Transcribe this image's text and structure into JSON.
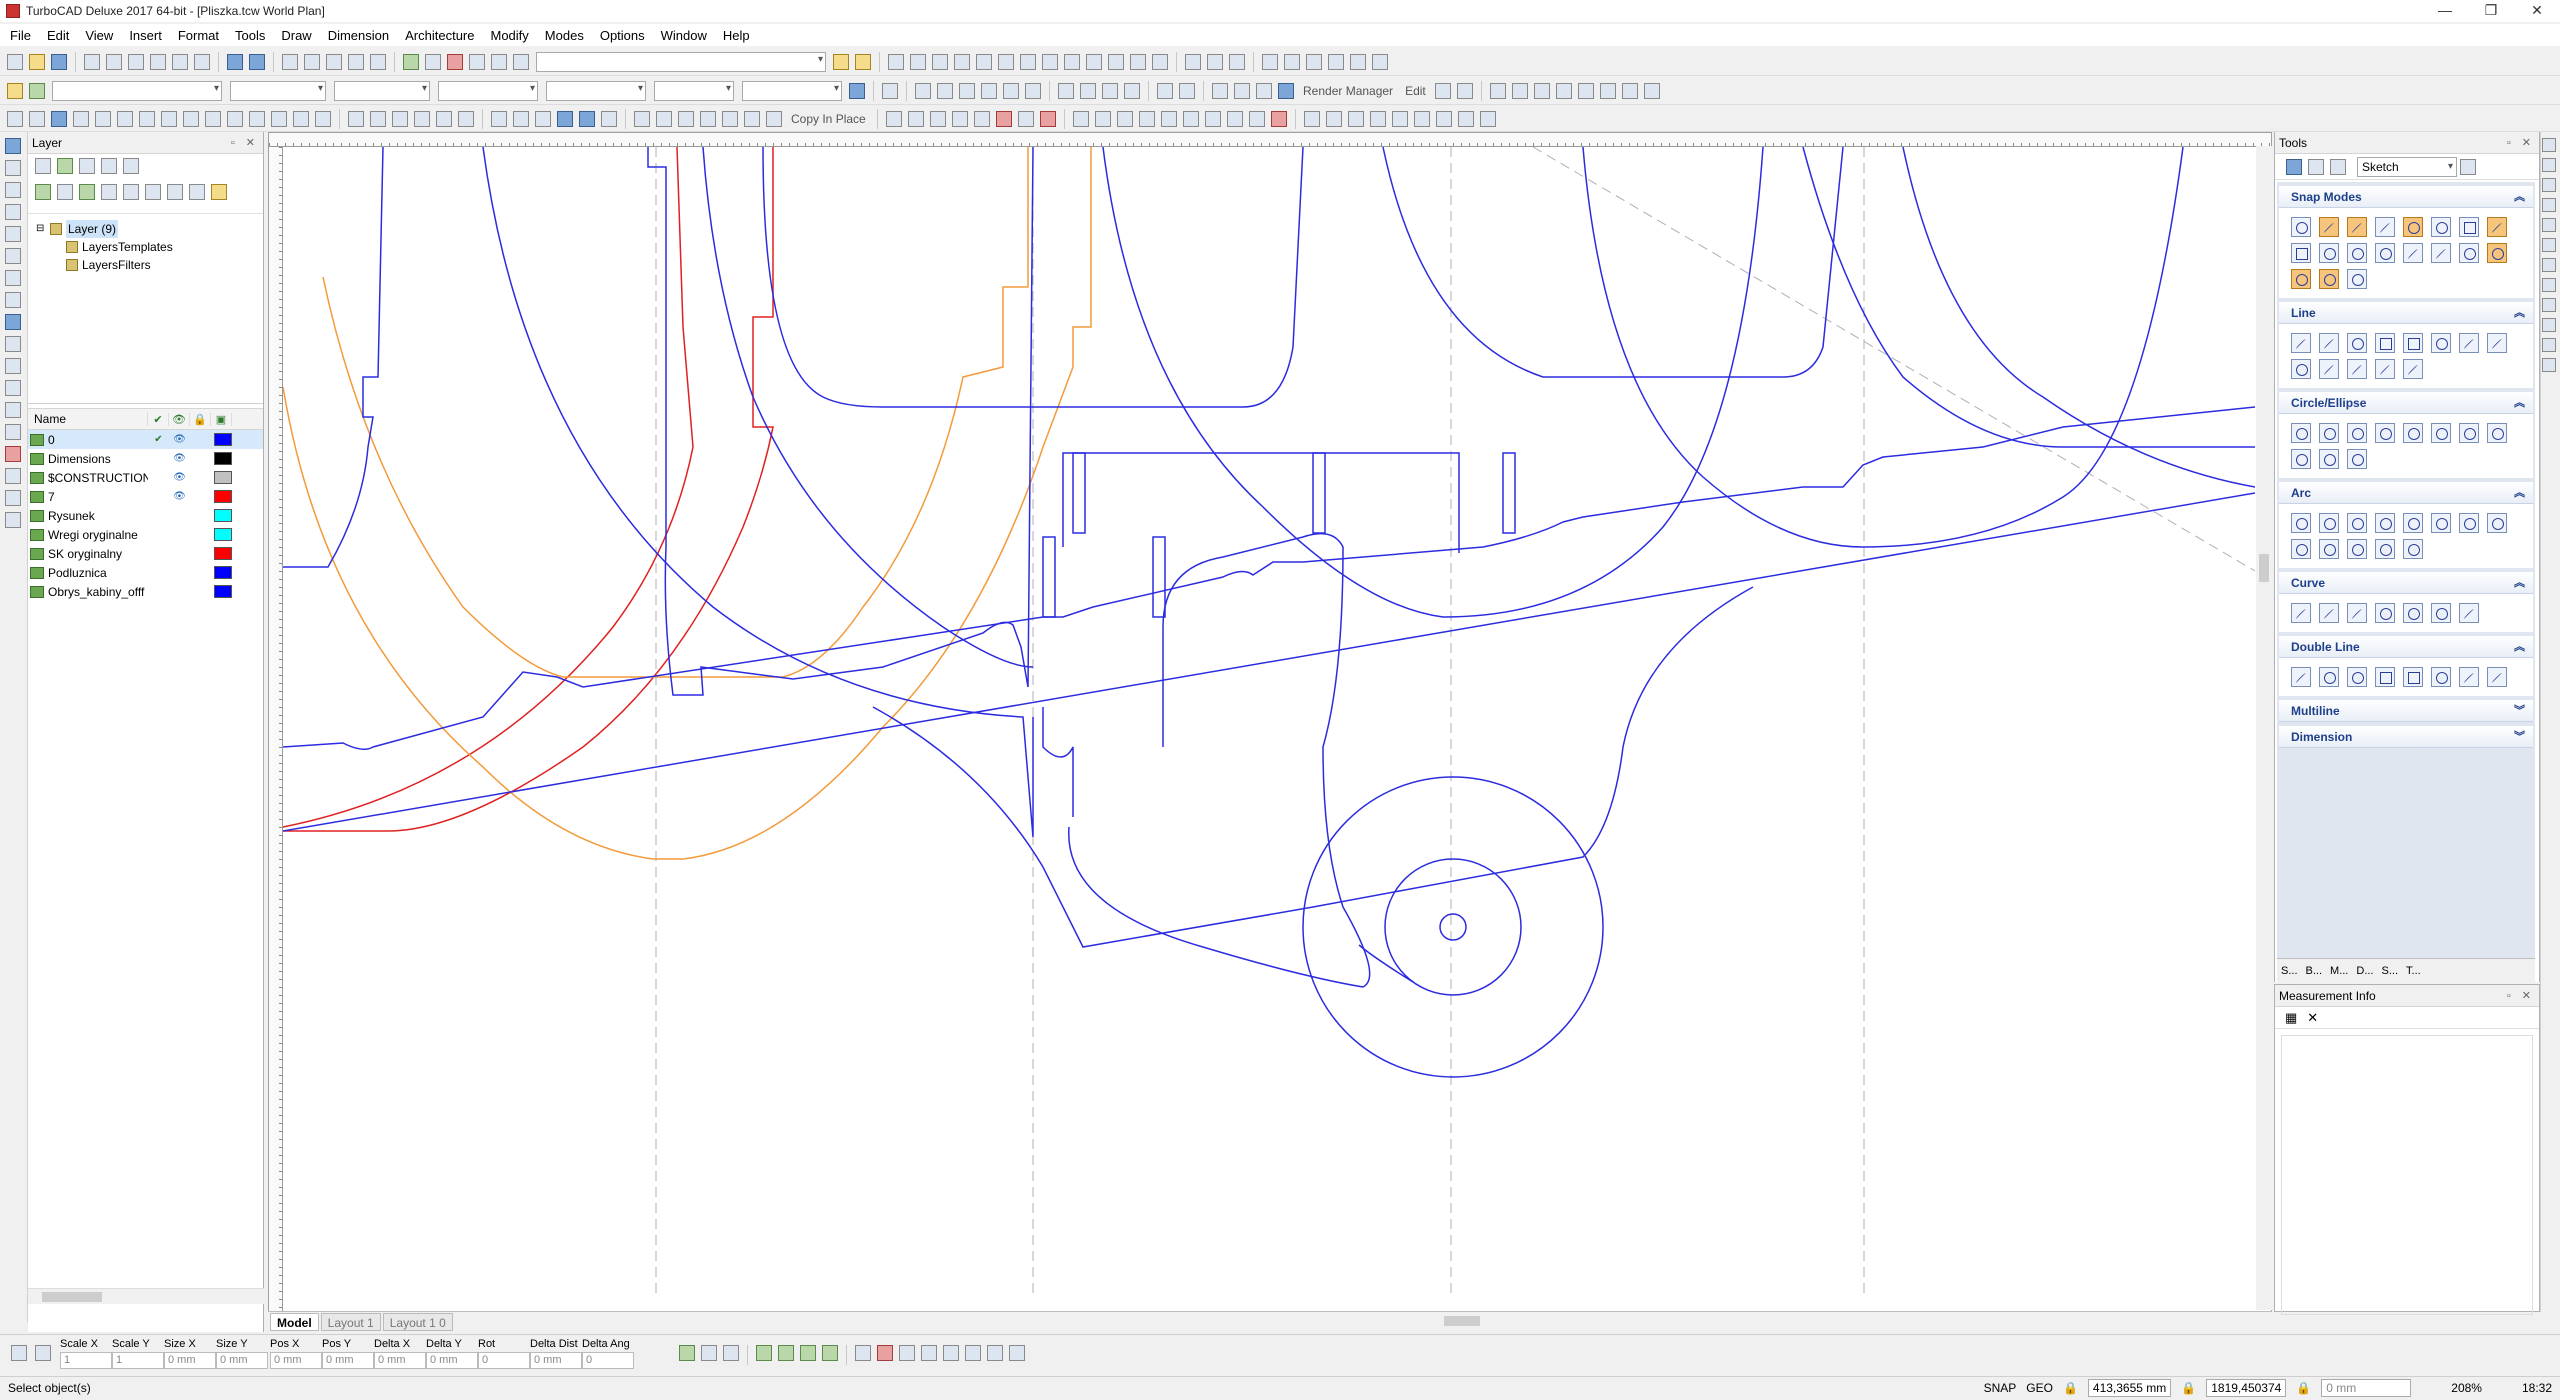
{
  "window": {
    "title": "TurboCAD Deluxe 2017 64-bit - [Pliszka.tcw World Plan]",
    "controls": [
      "—",
      "❐",
      "✕"
    ]
  },
  "menu": [
    "File",
    "Edit",
    "View",
    "Insert",
    "Format",
    "Tools",
    "Draw",
    "Dimension",
    "Architecture",
    "Modify",
    "Modes",
    "Options",
    "Window",
    "Help"
  ],
  "toolbar": {
    "render_manager": "Render Manager",
    "edit": "Edit",
    "copy_in_place": "Copy In Place"
  },
  "layer_panel": {
    "title": "Layer",
    "tree": {
      "root": "Layer (9)",
      "children": [
        "LayersTemplates",
        "LayersFilters"
      ]
    },
    "columns": {
      "name": "Name",
      "current": "✔",
      "visible": "👁",
      "lock": "🔒",
      "color": "▣"
    },
    "layers": [
      {
        "name": "0",
        "current": "✔",
        "visible": "👁",
        "color": "#0000ff"
      },
      {
        "name": "Dimensions",
        "current": "",
        "visible": "👁",
        "color": "#000000"
      },
      {
        "name": "$CONSTRUCTION",
        "current": "",
        "visible": "👁",
        "color": "#c0c0c0"
      },
      {
        "name": "7",
        "current": "",
        "visible": "👁",
        "color": "#ff0000"
      },
      {
        "name": "Rysunek",
        "current": "",
        "visible": "",
        "color": "#00ffff"
      },
      {
        "name": "Wregi oryginalne",
        "current": "",
        "visible": "",
        "color": "#00ffff"
      },
      {
        "name": "SK oryginalny",
        "current": "",
        "visible": "",
        "color": "#ff0000"
      },
      {
        "name": "Podluznica",
        "current": "",
        "visible": "",
        "color": "#0000ff"
      },
      {
        "name": "Obrys_kabiny_offf",
        "current": "",
        "visible": "",
        "color": "#0000ff"
      }
    ]
  },
  "drawing": {
    "tabs": [
      "Model",
      "Layout 1",
      "Layout 1 0"
    ],
    "colors": {
      "outline": "#2b2be0",
      "red": "#e02020",
      "orange": "#f39a3a",
      "construction": "#b0b0b0"
    }
  },
  "tools_panel": {
    "title": "Tools",
    "mode": "Sketch",
    "groups": [
      "Snap Modes",
      "Line",
      "Circle/Ellipse",
      "Arc",
      "Curve",
      "Double Line",
      "Multiline",
      "Dimension"
    ],
    "bottom_tabs": [
      "S...",
      "B...",
      "M...",
      "D...",
      "S...",
      "T..."
    ]
  },
  "measurement": {
    "title": "Measurement Info"
  },
  "inspector": {
    "fields": [
      {
        "label": "Scale X",
        "value": "1"
      },
      {
        "label": "Scale Y",
        "value": "1"
      },
      {
        "label": "Size X",
        "value": "0 mm"
      },
      {
        "label": "Size Y",
        "value": "0 mm"
      },
      {
        "label": "Pos X",
        "value": "0 mm"
      },
      {
        "label": "Pos Y",
        "value": "0 mm"
      },
      {
        "label": "Delta X",
        "value": "0 mm"
      },
      {
        "label": "Delta Y",
        "value": "0 mm"
      },
      {
        "label": "Rot",
        "value": "0"
      },
      {
        "label": "Delta Dist",
        "value": "0 mm"
      },
      {
        "label": "Delta Ang",
        "value": "0"
      }
    ]
  },
  "status": {
    "message": "Select object(s)",
    "snap": "SNAP",
    "geo": "GEO",
    "x": "413,3655 mm",
    "y": "1819,450374",
    "z": "0 mm",
    "zoom": "208%",
    "time": "18:32"
  }
}
